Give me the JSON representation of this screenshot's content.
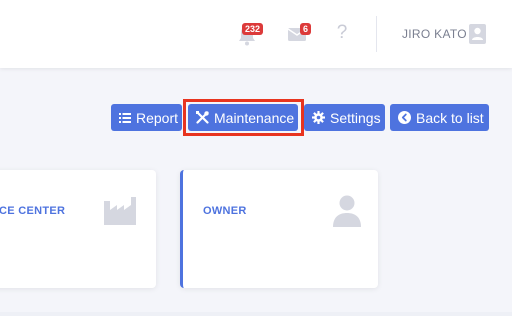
{
  "header": {
    "notifications_count": "232",
    "messages_count": "6",
    "help_glyph": "?",
    "user_name": "JIRO KATO"
  },
  "actions": {
    "report_label": "Report",
    "maintenance_label": "Maintenance",
    "settings_label": "Settings",
    "back_label": "Back to list"
  },
  "cards": [
    {
      "title": "RVICE CENTER",
      "icon": "factory-icon"
    },
    {
      "title": "OWNER",
      "icon": "person-icon"
    }
  ],
  "colors": {
    "primary": "#4e73df",
    "badge": "#dc3a3a",
    "highlight": "#e8341f",
    "icon_muted": "#d5d7e0"
  }
}
